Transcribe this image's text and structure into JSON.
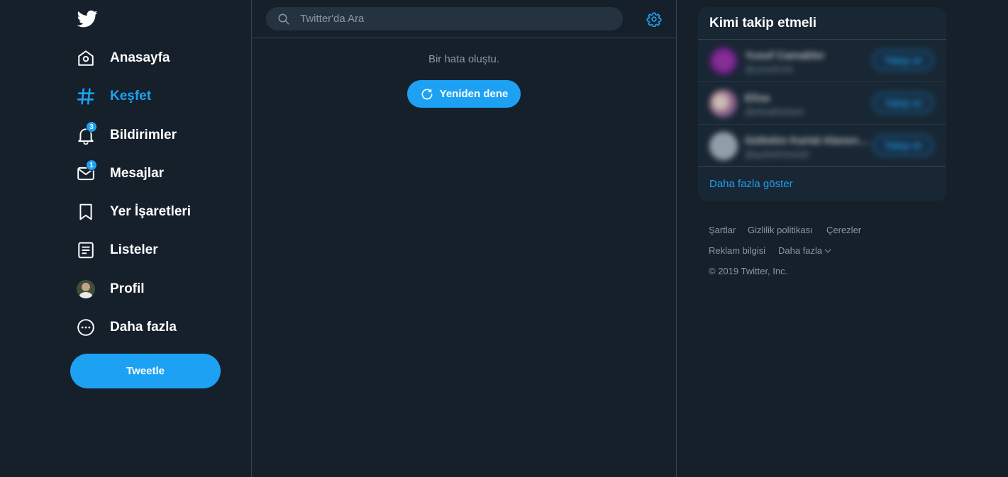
{
  "nav": {
    "items": [
      {
        "label": "Anasayfa",
        "icon": "home-icon"
      },
      {
        "label": "Keşfet",
        "icon": "hashtag-icon",
        "active": true
      },
      {
        "label": "Bildirimler",
        "icon": "bell-icon",
        "badge": "3"
      },
      {
        "label": "Mesajlar",
        "icon": "mail-icon",
        "badge": "1"
      },
      {
        "label": "Yer İşaretleri",
        "icon": "bookmark-icon"
      },
      {
        "label": "Listeler",
        "icon": "list-icon"
      },
      {
        "label": "Profil",
        "icon": "avatar"
      },
      {
        "label": "Daha fazla",
        "icon": "more-circle-icon"
      }
    ],
    "tweet_label": "Tweetle"
  },
  "main": {
    "search_placeholder": "Twitter'da Ara",
    "error_text": "Bir hata oluştu.",
    "retry_label": "Yeniden dene"
  },
  "who_to_follow": {
    "title": "Kimi takip etmeli",
    "suggestions": [
      {
        "name": "Yusuf Camakler",
        "handle": "@yusufcmk",
        "follow_label": "Takip et"
      },
      {
        "name": "Elisa",
        "handle": "@elisathebest",
        "follow_label": "Takip et"
      },
      {
        "name": "Gültekin Kartal Alanen…",
        "handle": "@gultekinkartal",
        "follow_label": "Takip et"
      }
    ],
    "show_more": "Daha fazla göster"
  },
  "footer": {
    "terms": "Şartlar",
    "privacy": "Gizlilik politikası",
    "cookies": "Çerezler",
    "ads_info": "Reklam bilgisi",
    "more": "Daha fazla",
    "copyright": "© 2019 Twitter, Inc."
  },
  "colors": {
    "background": "#15202b",
    "accent": "#1da1f2",
    "card": "#192734",
    "border": "#38444d",
    "muted_text": "#8899a6"
  }
}
